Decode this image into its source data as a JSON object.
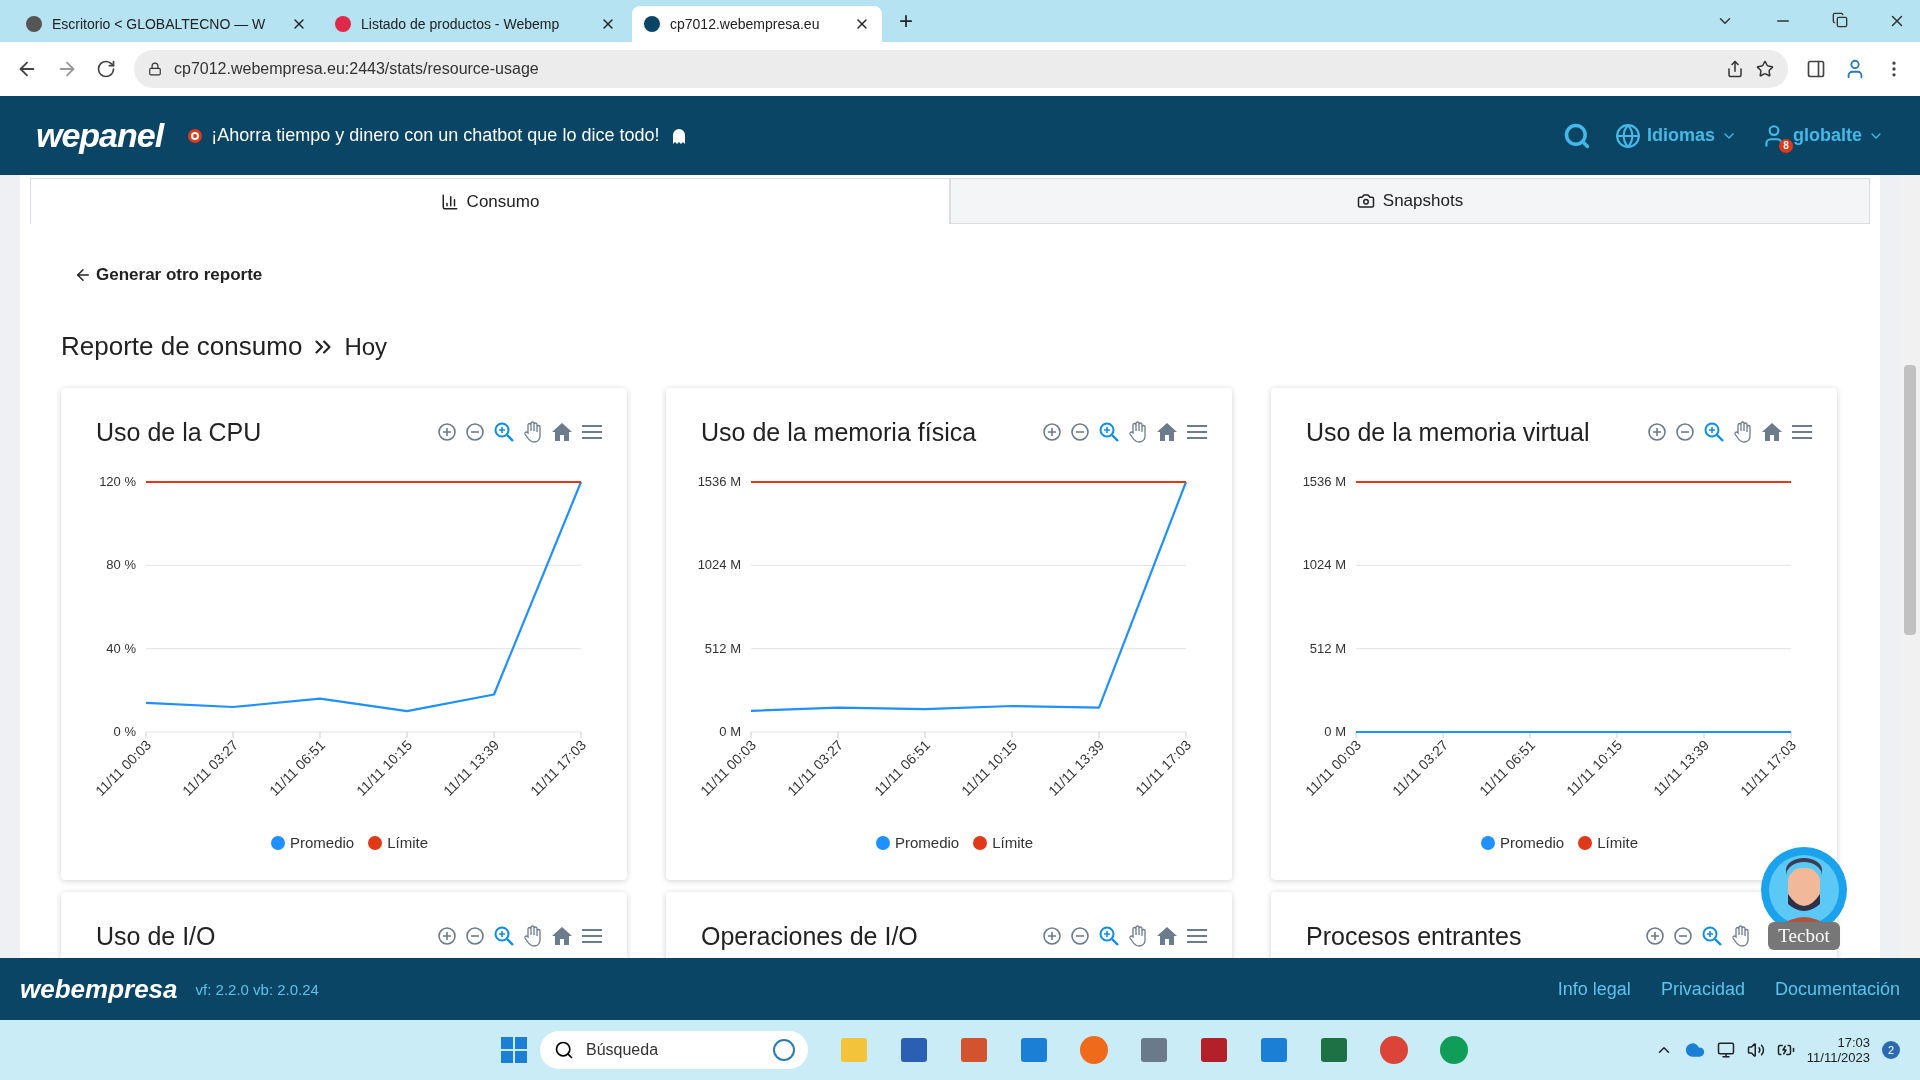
{
  "browser": {
    "tabs": [
      {
        "label": "Escritorio < GLOBALTECNO — W",
        "selected": false
      },
      {
        "label": "Listado de productos - Webemp",
        "selected": false
      },
      {
        "label": "cp7012.webempresa.eu",
        "selected": true
      }
    ],
    "new_tab": "+",
    "url": "cp7012.webempresa.eu:2443/stats/resource-usage"
  },
  "header": {
    "logo": "wepanel",
    "banner": "¡Ahorra tiempo y dinero con un chatbot que lo dice todo!",
    "language": "Idiomas",
    "user": "globalte",
    "notifications": "8"
  },
  "tabs": [
    {
      "label": "Consumo",
      "selected": true
    },
    {
      "label": "Snapshots",
      "selected": false
    }
  ],
  "back_link": "Generar otro reporte",
  "heading": {
    "title": "Reporte de consumo",
    "period": "Hoy"
  },
  "charts": [
    {
      "chart_data": {
        "type": "line",
        "title": "Uso de la CPU",
        "ylim": [
          0,
          120
        ],
        "categories": [
          "11/11 00:03",
          "11/11 03:27",
          "11/11 06:51",
          "11/11 10:15",
          "11/11 13:39",
          "11/11 17:03"
        ],
        "yticks": [
          {
            "value": 0,
            "label": "0 %"
          },
          {
            "value": 40,
            "label": "40 %"
          },
          {
            "value": 80,
            "label": "80 %"
          },
          {
            "value": 120,
            "label": "120 %"
          }
        ],
        "series": [
          {
            "name": "Promedio",
            "color": "#1e90ff",
            "values": [
              14,
              12,
              16,
              10,
              18,
              120
            ]
          },
          {
            "name": "Límite",
            "color": "#e0391a",
            "values": [
              120,
              120,
              120,
              120,
              120,
              120
            ]
          }
        ]
      }
    },
    {
      "chart_data": {
        "type": "line",
        "title": "Uso de la memoria física",
        "ylim": [
          0,
          1536
        ],
        "categories": [
          "11/11 00:03",
          "11/11 03:27",
          "11/11 06:51",
          "11/11 10:15",
          "11/11 13:39",
          "11/11 17:03"
        ],
        "yticks": [
          {
            "value": 0,
            "label": "0 M"
          },
          {
            "value": 512,
            "label": "512 M"
          },
          {
            "value": 1024,
            "label": "1024 M"
          },
          {
            "value": 1536,
            "label": "1536 M"
          }
        ],
        "series": [
          {
            "name": "Promedio",
            "color": "#1e90ff",
            "values": [
              130,
              150,
              140,
              160,
              150,
              1536
            ]
          },
          {
            "name": "Límite",
            "color": "#e0391a",
            "values": [
              1536,
              1536,
              1536,
              1536,
              1536,
              1536
            ]
          }
        ]
      }
    },
    {
      "chart_data": {
        "type": "line",
        "title": "Uso de la memoria virtual",
        "ylim": [
          0,
          1536
        ],
        "categories": [
          "11/11 00:03",
          "11/11 03:27",
          "11/11 06:51",
          "11/11 10:15",
          "11/11 13:39",
          "11/11 17:03"
        ],
        "yticks": [
          {
            "value": 0,
            "label": "0 M"
          },
          {
            "value": 512,
            "label": "512 M"
          },
          {
            "value": 1024,
            "label": "1024 M"
          },
          {
            "value": 1536,
            "label": "1536 M"
          }
        ],
        "series": [
          {
            "name": "Promedio",
            "color": "#1e90ff",
            "values": [
              0,
              0,
              0,
              0,
              0,
              0
            ]
          },
          {
            "name": "Límite",
            "color": "#e0391a",
            "values": [
              1536,
              1536,
              1536,
              1536,
              1536,
              1536
            ]
          }
        ]
      }
    }
  ],
  "more_charts": [
    {
      "title": "Uso de I/O"
    },
    {
      "title": "Operaciones de I/O"
    },
    {
      "title": "Procesos entrantes"
    }
  ],
  "chatbot": {
    "label": "Tecbot"
  },
  "footer": {
    "logo": "webempresa",
    "version": "vf: 2.2.0 vb: 2.0.24",
    "links": [
      "Info legal",
      "Privacidad",
      "Documentación"
    ]
  },
  "taskbar": {
    "search_placeholder": "Búsqueda",
    "time": "17:03",
    "date": "11/11/2023",
    "notifications": "2"
  }
}
